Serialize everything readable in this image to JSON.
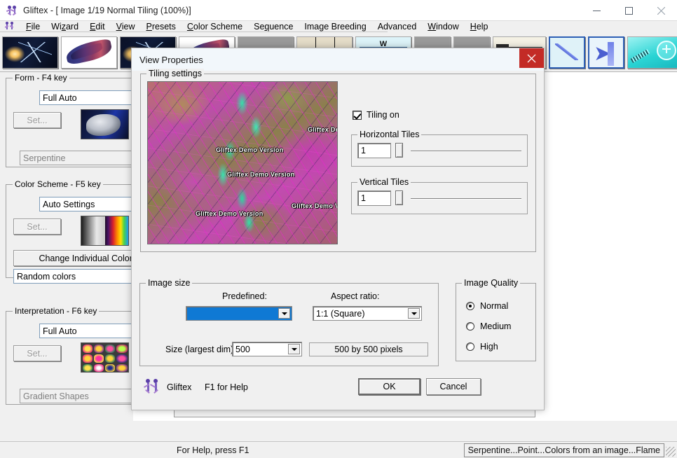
{
  "window": {
    "title": "Gliftex - [ Image 1/19 Normal Tiling (100%)]",
    "app_icon": "gliftex-figures-icon",
    "minimize": "—",
    "maximize": "☐",
    "close": "✕"
  },
  "mdi": {
    "minimize": "–",
    "restore": "❐",
    "close": "✕"
  },
  "menu": {
    "icon": "gliftex-figures-icon",
    "items": [
      {
        "label": "File",
        "accel": "F"
      },
      {
        "label": "Wizard",
        "accel": "z"
      },
      {
        "label": "Edit",
        "accel": "E"
      },
      {
        "label": "View",
        "accel": "V"
      },
      {
        "label": "Presets",
        "accel": "P"
      },
      {
        "label": "Color Scheme",
        "accel": "C"
      },
      {
        "label": "Sequence",
        "accel": "q"
      },
      {
        "label": "Image Breeding",
        "accel": ""
      },
      {
        "label": "Advanced",
        "accel": ""
      },
      {
        "label": "Window",
        "accel": "W"
      },
      {
        "label": "Help",
        "accel": "H"
      }
    ]
  },
  "toolbar": {
    "items": [
      {
        "name": "thumb-lightning",
        "icon": "lightning-thumbnail"
      },
      {
        "name": "thumb-feather",
        "icon": "feather-thumbnail"
      },
      {
        "name": "thumb-lightning-2",
        "icon": "lightning-thumbnail"
      },
      {
        "name": "thumb-feather-2",
        "icon": "feather-thumbnail"
      },
      {
        "name": "thumb-grey",
        "icon": "grey-swatch-thumbnail"
      },
      {
        "name": "thumb-tiles",
        "icon": "tiles-thumbnail"
      },
      {
        "name": "thumb-wcard",
        "icon": "w-card-thumbnail"
      },
      {
        "name": "thumb-grey-2",
        "icon": "grey-swatch-thumbnail"
      },
      {
        "name": "thumb-grey-3",
        "icon": "grey-swatch-thumbnail"
      },
      {
        "name": "thumb-film",
        "icon": "film-strip-thumbnail"
      },
      {
        "name": "thumb-diagonal",
        "icon": "diagonal-brush-thumbnail"
      },
      {
        "name": "thumb-arrow-bar",
        "icon": "arrow-to-bar-icon"
      },
      {
        "name": "thumb-zoom-in",
        "icon": "magnifier-plus-icon"
      },
      {
        "name": "thumb-zoom-out",
        "icon": "magnifier-minus-icon"
      }
    ]
  },
  "sidebar": {
    "form": {
      "legend": "Form - F4 key",
      "combo_value": "Full Auto",
      "set_button": "Set...",
      "preview_icon": "sculpture-preview",
      "status_value": "Serpentine"
    },
    "color_scheme": {
      "legend": "Color Scheme - F5 key",
      "combo_value": "Auto Settings",
      "set_button": "Set...",
      "preview_icon": "spectrum-preview",
      "change_colors_button": "Change Individual Colors...",
      "status_value": "Random colors"
    },
    "interpretation": {
      "legend": "Interpretation - F6 key",
      "combo_value": "Full Auto",
      "set_button": "Set...",
      "preview_icon": "gradient-shapes-preview",
      "status_value": "Gradient Shapes"
    }
  },
  "dialog": {
    "title": "View Properties",
    "close_icon": "close-icon",
    "tiling": {
      "legend": "Tiling settings",
      "preview_watermarks": [
        "Gliftex De",
        "Gliftex Demo Version",
        "Gliftex Demo Version",
        "Gliftex Demo Ver",
        "Gliftex Demo Version"
      ],
      "tiling_on_label": "Tiling on",
      "tiling_on_checked": true,
      "horizontal": {
        "legend": "Horizontal Tiles",
        "value": "1",
        "slider_pos_pct": 0
      },
      "vertical": {
        "legend": "Vertical Tiles",
        "value": "1",
        "slider_pos_pct": 0
      }
    },
    "image_size": {
      "legend": "Image size",
      "predefined_label": "Predefined:",
      "predefined_value": "",
      "aspect_label": "Aspect ratio:",
      "aspect_value": "1:1 (Square)",
      "size_label": "Size (largest dim)",
      "size_value": "500",
      "readout": "500 by 500 pixels"
    },
    "image_quality": {
      "legend": "Image Quality",
      "options": [
        {
          "label": "Normal",
          "selected": true
        },
        {
          "label": "Medium",
          "selected": false
        },
        {
          "label": "High",
          "selected": false
        }
      ]
    },
    "footer": {
      "brand_icon": "gliftex-figures-icon",
      "brand": "Gliftex",
      "help_hint": "F1 for Help",
      "ok": "OK",
      "cancel": "Cancel"
    }
  },
  "statusbar": {
    "left": "For Help, press F1",
    "right": "Serpentine...Point...Colors from an image...Flame"
  },
  "colors": {
    "accent_selected": "#0f79d4",
    "close_red": "#c32b26",
    "dialog_bg": "#f0f0f0",
    "titlebar_bg": "#ffffff"
  }
}
